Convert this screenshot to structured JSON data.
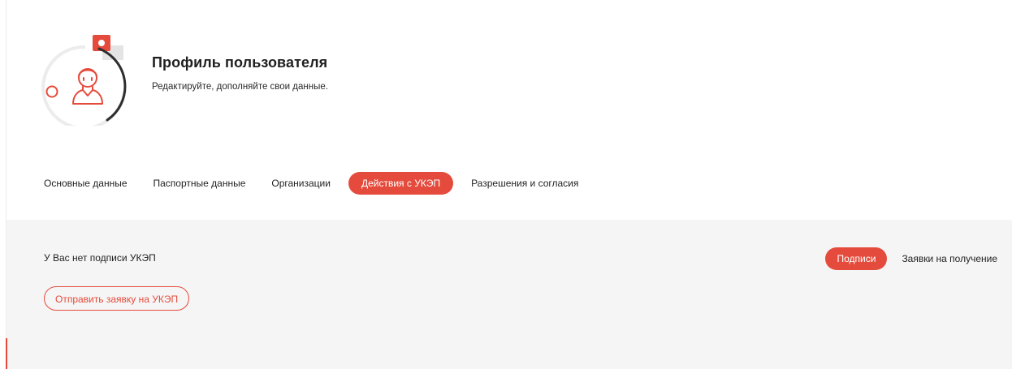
{
  "profile": {
    "title": "Профиль пользователя",
    "subtitle": "Редактируйте, дополняйте свои данные."
  },
  "tabs": [
    {
      "label": "Основные данные",
      "active": false
    },
    {
      "label": "Паспортные данные",
      "active": false
    },
    {
      "label": "Организации",
      "active": false
    },
    {
      "label": "Действия с УКЭП",
      "active": true
    },
    {
      "label": "Разрешения и согласия",
      "active": false
    }
  ],
  "ukep": {
    "status_text": "У Вас нет подписи УКЭП",
    "request_button_label": "Отправить заявку на УКЭП",
    "subtabs": [
      {
        "label": "Подписи",
        "active": true
      },
      {
        "label": "Заявки на получение",
        "active": false
      }
    ]
  },
  "icons": {
    "avatar": "user-avatar-icon",
    "badge": "shield-emblem-icon"
  },
  "colors": {
    "accent": "#e54b3c",
    "panel_background": "#f5f5f5",
    "text": "#1f1f1f"
  }
}
